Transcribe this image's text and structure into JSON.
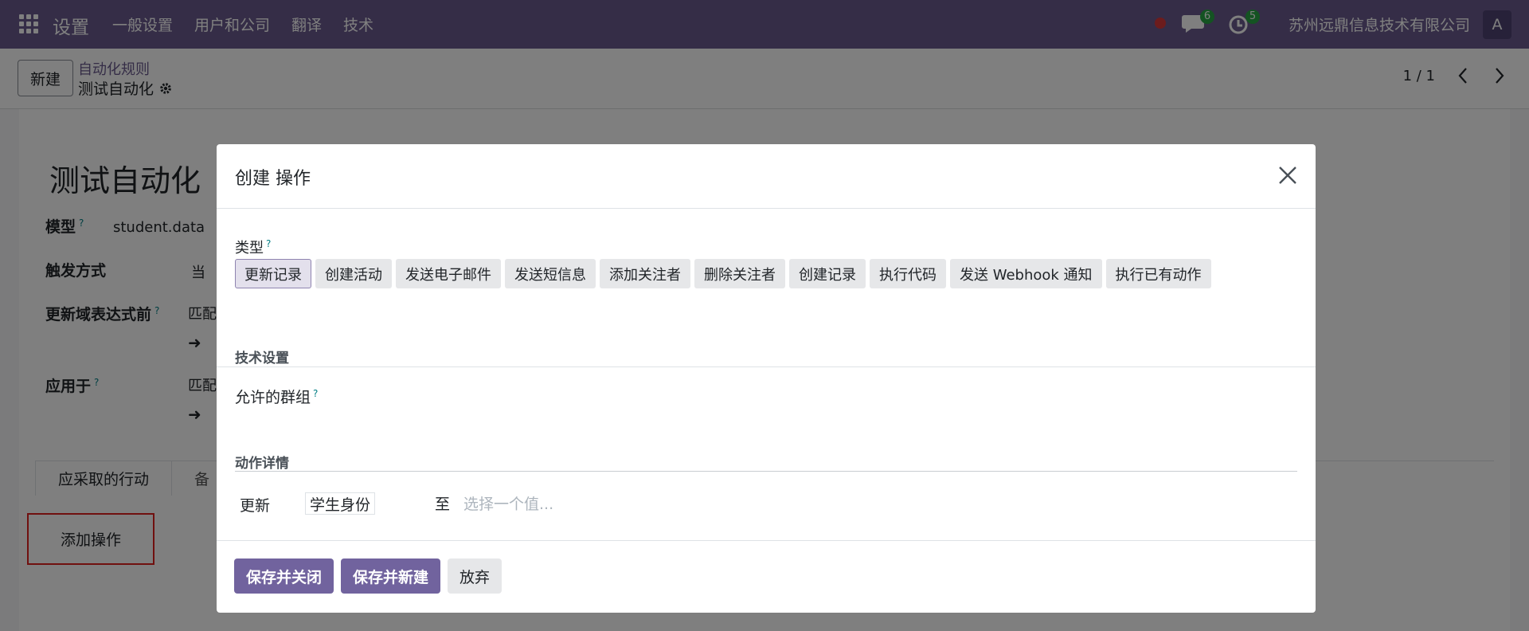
{
  "navbar": {
    "app_name": "设置",
    "menu": [
      "一般设置",
      "用户和公司",
      "翻译",
      "技术"
    ],
    "chat_count": "6",
    "activity_count": "5",
    "company": "苏州远鼎信息技术有限公司",
    "avatar_letter": "A"
  },
  "control": {
    "new_label": "新建",
    "breadcrumb_parent": "自动化规则",
    "breadcrumb_current": "测试自动化",
    "pager": "1 / 1"
  },
  "form": {
    "title": "测试自动化",
    "model_label": "模型",
    "model_value": "student.data",
    "trigger_label": "触发方式",
    "trigger_value": "当",
    "before_domain_label": "更新域表达式前",
    "before_domain_value": "匹配",
    "apply_label": "应用于",
    "apply_value": "匹配",
    "tab_actions": "应采取的行动",
    "tab_notes": "备",
    "add_action": "添加操作"
  },
  "modal": {
    "title": "创建 操作",
    "type_label": "类型",
    "types": [
      "更新记录",
      "创建活动",
      "发送电子邮件",
      "发送短信息",
      "添加关注者",
      "删除关注者",
      "创建记录",
      "执行代码",
      "发送 Webhook 通知",
      "执行已有动作"
    ],
    "tech_settings": "技术设置",
    "groups_label": "允许的群组",
    "details_title": "动作详情",
    "update_label": "更新",
    "update_field": "学生身份",
    "to_label": "至",
    "value_placeholder": "选择一个值...",
    "save_close": "保存并关闭",
    "save_new": "保存并新建",
    "discard": "放弃"
  },
  "colors": {
    "navbar": "#6b5b8f",
    "primary_button": "#71639e",
    "badge": "#28a745",
    "highlight_box": "#e0201f"
  }
}
